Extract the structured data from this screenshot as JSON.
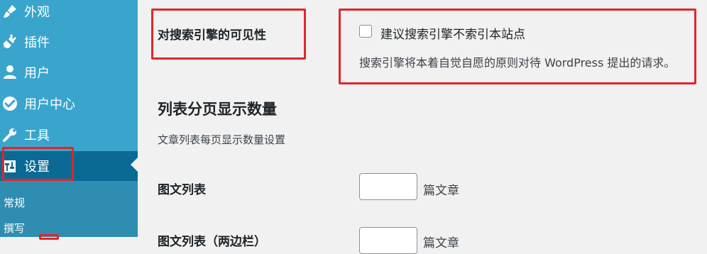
{
  "sidebar": {
    "items": [
      {
        "label": "外观",
        "icon": "paintbrush-icon"
      },
      {
        "label": "插件",
        "icon": "plugin-icon"
      },
      {
        "label": "用户",
        "icon": "user-icon"
      },
      {
        "label": "用户中心",
        "icon": "check-badge-icon"
      },
      {
        "label": "工具",
        "icon": "wrench-icon"
      },
      {
        "label": "设置",
        "icon": "settings-icon",
        "active": true
      }
    ],
    "submenu": [
      {
        "label": "常规"
      },
      {
        "label": "撰写"
      }
    ]
  },
  "main": {
    "visibility": {
      "label": "对搜索引擎的可见性",
      "checkbox_label": "建议搜索引擎不索引本站点",
      "checked": false,
      "description": "搜索引擎将本着自觉自愿的原则对待 WordPress 提出的请求。"
    },
    "pagination": {
      "title": "列表分页显示数量",
      "description": "文章列表每页显示数量设置",
      "fields": [
        {
          "label": "图文列表",
          "value": "",
          "suffix": "篇文章"
        },
        {
          "label": "图文列表（两边栏）",
          "value": "",
          "suffix": "篇文章"
        }
      ]
    }
  },
  "colors": {
    "sidebar_bg": "#3aa5cc",
    "sidebar_active": "#0b6a93",
    "annotation_red": "#e0262b",
    "page_bg": "#f1f1f1"
  }
}
